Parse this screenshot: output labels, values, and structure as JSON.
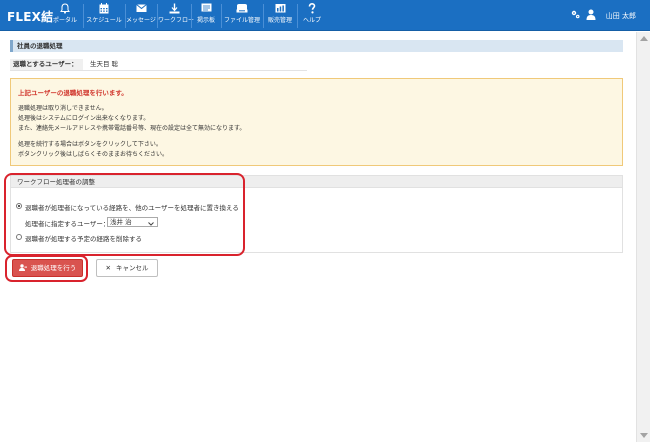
{
  "app": {
    "brand": "FLEX結"
  },
  "nav": {
    "items": [
      {
        "label": "ポータル",
        "icon": "bell-icon"
      },
      {
        "label": "スケジュール",
        "icon": "calendar-icon"
      },
      {
        "label": "メッセージ",
        "icon": "envelope-icon"
      },
      {
        "label": "ワークフロー",
        "icon": "workflow-icon"
      },
      {
        "label": "掲示板",
        "icon": "board-icon"
      },
      {
        "label": "ファイル管理",
        "icon": "folder-icon"
      },
      {
        "label": "販売管理",
        "icon": "sales-icon"
      },
      {
        "label": "ヘルプ",
        "icon": "help-icon"
      }
    ]
  },
  "user": {
    "name": "山田 太郎"
  },
  "page": {
    "title": "社員の退職処理",
    "target_label": "退職とするユーザー：",
    "target_value": "生天目 聡"
  },
  "warning": {
    "title": "上記ユーザーの退職処理を行います。",
    "lines": [
      "退職処理は取り消しできません。",
      "処理後はシステムにログイン出来なくなります。",
      "また、連絡先メールアドレスや携帯電話番号等、現在の設定は全て無効になります。",
      "処理を続行する場合はボタンをクリックして下さい。",
      "ボタンクリック後はしばらくそのままお待ちください。"
    ]
  },
  "workflow": {
    "header": "ワークフロー処理者の調整",
    "option1": "退職者が処理者になっている経路を、他のユーザーを処理者に置き換える",
    "assignee_label": "処理者に指定するユーザー：",
    "assignee_value": "浅井 治",
    "option2": "退職者が処理する予定の経路を削除する"
  },
  "buttons": {
    "submit": "退職処理を行う",
    "cancel": "キャンセル"
  },
  "colors": {
    "nav_bg": "#1b6fc2",
    "danger": "#d9534f",
    "highlight": "#d9232d",
    "warning_bg": "#fdf7e3"
  }
}
